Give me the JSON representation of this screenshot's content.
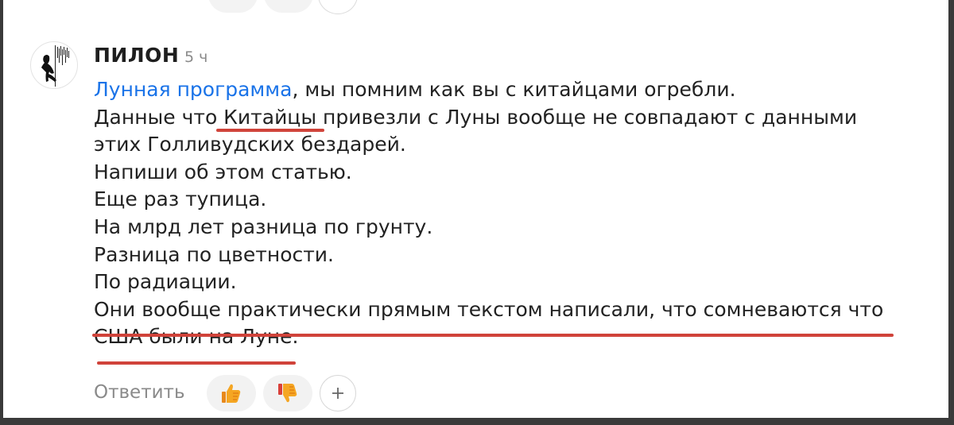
{
  "comment": {
    "author": "ПИЛОН",
    "time": "5 ч",
    "mention": "Лунная программа",
    "line1_rest": ", мы помним как вы с китайцами огребли.",
    "line2": "Данные что Китайцы привезли с Луны вообще не совпадают с данными",
    "line3": "этих Голливудских бездарей.",
    "line4": "Напиши об этом статью.",
    "line5": "Еще раз тупица.",
    "line6": "На млрд лет разница по грунту.",
    "line7": "Разница по цветности.",
    "line8": "По радиации.",
    "line9": "Они вообще практически прямым текстом написали, что сомневаются что",
    "line10": "США были на Луне."
  },
  "actions": {
    "reply_label": "Ответить"
  },
  "colors": {
    "mention": "#1a73e8",
    "underline": "#d0433a",
    "thumbs": "#f5a623"
  },
  "icons": [
    "avatar-silhouette",
    "thumbs-up-icon",
    "thumbs-down-icon",
    "plus-icon"
  ]
}
